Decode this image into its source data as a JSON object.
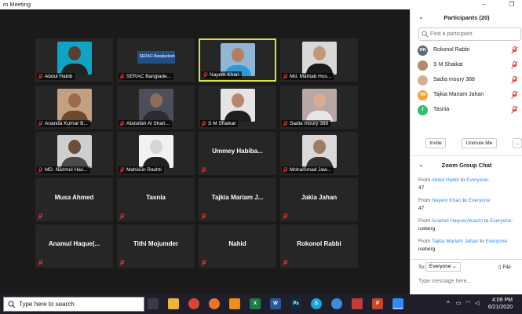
{
  "window": {
    "title": "m Meeting",
    "controls": [
      "–",
      "❐"
    ]
  },
  "tiles": [
    {
      "name": "Abdul Habib",
      "kind": "photo",
      "skin": "#5b3f2e",
      "bg": "#0ea4c4",
      "shirt": "#222222"
    },
    {
      "name": "SERAC Banglade...",
      "kind": "logo",
      "logo_text": "SERAC-Bangladesh",
      "bg": "#1f4f8a"
    },
    {
      "name": "Nayem Khan",
      "kind": "photo",
      "skin": "#b57e5f",
      "bg": "#8fb7d3",
      "shirt": "#2c9ad6",
      "active": true
    },
    {
      "name": "Md. Mahtab Hos...",
      "kind": "photo",
      "skin": "#c2977b",
      "bg": "#d8d8d8",
      "shirt": "#1b1b1b"
    },
    {
      "name": "Ananda Kumar B...",
      "kind": "photo",
      "skin": "#9c6b49",
      "bg": "#c4a083",
      "shirt": "#6c4a31"
    },
    {
      "name": "Abdullah Al Shari...",
      "kind": "photo",
      "skin": "#8d6e5c",
      "bg": "#4d4d5c",
      "shirt": "#2b2b36"
    },
    {
      "name": "S M Shaikat",
      "kind": "photo",
      "skin": "#b9876c",
      "bg": "#e4e4e4",
      "shirt": "#1e1e1e"
    },
    {
      "name": "Sadia moury 388",
      "kind": "photo",
      "skin": "#d8ad96",
      "bg": "#b8a7a2",
      "shirt": "#e6e6e6"
    },
    {
      "name": "MD. Nazmul Has...",
      "kind": "photo",
      "skin": "#6b4f3d",
      "bg": "#cfcfcf",
      "shirt": "#4a4a4a"
    },
    {
      "name": "Mahisun Rashti",
      "kind": "photo",
      "skin": "#d6d6d6",
      "bg": "#f2f2f2",
      "shirt": "#222222"
    },
    {
      "name": "Ummey Habiba...",
      "kind": "text"
    },
    {
      "name": "Mohammad Jaw...",
      "kind": "photo",
      "skin": "#a07c67",
      "bg": "#d9d9d9",
      "shirt": "#333333"
    },
    {
      "name": "Musa Ahmed",
      "kind": "text"
    },
    {
      "name": "Tasnia",
      "kind": "text"
    },
    {
      "name": "Tajkia Mariam J...",
      "kind": "text"
    },
    {
      "name": "Jakia Jahan",
      "kind": "text"
    },
    {
      "name": "Anamul Haque(...",
      "kind": "text"
    },
    {
      "name": "Tithi Mojumder",
      "kind": "text"
    },
    {
      "name": "Nahid",
      "kind": "text"
    },
    {
      "name": "Rokonol Rabbi",
      "kind": "text"
    }
  ],
  "participants_panel": {
    "title": "Participants (20)",
    "search_placeholder": "Find a participant",
    "items": [
      {
        "name": "Rokonol Rabbi",
        "initials": "RR",
        "color": "#5c6b7d"
      },
      {
        "name": "S M Shaikat",
        "initials": "",
        "color": "#b9876c"
      },
      {
        "name": "Sadia moury 388",
        "initials": "",
        "color": "#d8ad96"
      },
      {
        "name": "Tajkia Mariam Jahan",
        "initials": "TM",
        "color": "#f2a33a"
      },
      {
        "name": "Tasnia",
        "initials": "T",
        "color": "#2fbf71"
      }
    ],
    "buttons": {
      "invite": "Invite",
      "unmute": "Unmute Me",
      "more": "..."
    }
  },
  "chat": {
    "title": "Zoom Group Chat",
    "messages": [
      {
        "from_prefix": "From",
        "sender": "Abdul Habib",
        "to_text": "to",
        "recipient": "Everyone",
        "text": "47"
      },
      {
        "from_prefix": "From",
        "sender": "Nayem Khan",
        "to_text": "to",
        "recipient": "Everyone",
        "text": "47"
      },
      {
        "from_prefix": "From",
        "sender": "Anamul Haque(Akash)",
        "to_text": "to",
        "recipient": "Everyone",
        "text": "iceberg"
      },
      {
        "from_prefix": "From",
        "sender": "Tajkia Mariam Jahan",
        "to_text": "to",
        "recipient": "Everyone",
        "text": "iceberg"
      }
    ],
    "to_label": "To:",
    "to_value": "Everyone",
    "file_label": "File",
    "input_placeholder": "Type message here..."
  },
  "taskbar": {
    "search_placeholder": "Type here to search",
    "apps": [
      {
        "name": "task-view",
        "label": "",
        "color": "#3a3a4a"
      },
      {
        "name": "file-explorer",
        "label": "",
        "color": "#e9b63b"
      },
      {
        "name": "chrome",
        "label": "",
        "color": "#d94535"
      },
      {
        "name": "firefox",
        "label": "",
        "color": "#e8742a"
      },
      {
        "name": "vlc",
        "label": "",
        "color": "#f28c18"
      },
      {
        "name": "excel",
        "label": "X",
        "color": "#1f7a44"
      },
      {
        "name": "word",
        "label": "W",
        "color": "#2b5797"
      },
      {
        "name": "photoshop",
        "label": "Ps",
        "color": "#0f2b46"
      },
      {
        "name": "skype",
        "label": "S",
        "color": "#1ba6e0"
      },
      {
        "name": "browser-globe",
        "label": "",
        "color": "#3b8fd9"
      },
      {
        "name": "media",
        "label": "",
        "color": "#c43b3b"
      },
      {
        "name": "powerpoint",
        "label": "P",
        "color": "#c9452a"
      },
      {
        "name": "zoom",
        "label": "",
        "color": "#2d8cff"
      }
    ],
    "time": "4:09 PM",
    "date": "6/21/2020"
  },
  "colors": {
    "accent": "#2d8cff",
    "active_speaker": "#d8e04a",
    "mute_red": "#e0373b"
  }
}
